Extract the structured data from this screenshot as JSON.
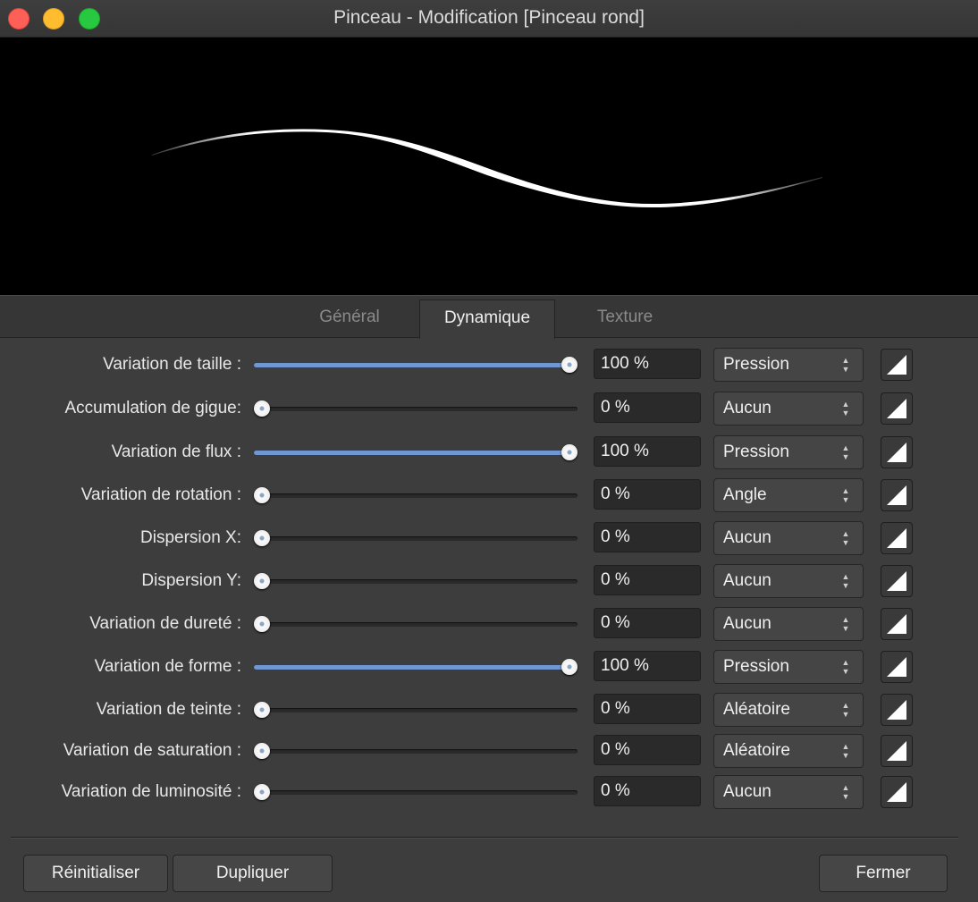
{
  "window": {
    "title": "Pinceau - Modification [Pinceau rond]"
  },
  "tabs": [
    {
      "label": "Général",
      "active": false
    },
    {
      "label": "Dynamique",
      "active": true
    },
    {
      "label": "Texture",
      "active": false
    }
  ],
  "rows": [
    {
      "label": "Variation de taille :",
      "value": "100 %",
      "level": 1.0,
      "controller": "Pression"
    },
    {
      "label": "Accumulation de gigue:",
      "value": "0 %",
      "level": 0.0,
      "controller": "Aucun"
    },
    {
      "label": "Variation de flux :",
      "value": "100 %",
      "level": 1.0,
      "controller": "Pression"
    },
    {
      "label": "Variation de rotation :",
      "value": "0 %",
      "level": 0.0,
      "controller": "Angle"
    },
    {
      "label": "Dispersion X:",
      "value": "0 %",
      "level": 0.0,
      "controller": "Aucun"
    },
    {
      "label": "Dispersion Y:",
      "value": "0 %",
      "level": 0.0,
      "controller": "Aucun"
    },
    {
      "label": "Variation de dureté :",
      "value": "0 %",
      "level": 0.0,
      "controller": "Aucun"
    },
    {
      "label": "Variation de forme :",
      "value": "100 %",
      "level": 1.0,
      "controller": "Pression"
    },
    {
      "label": "Variation de teinte :",
      "value": "0 %",
      "level": 0.0,
      "controller": "Aléatoire"
    },
    {
      "label": "Variation de saturation :",
      "value": "0 %",
      "level": 0.0,
      "controller": "Aléatoire"
    },
    {
      "label": "Variation de luminosité :",
      "value": "0 %",
      "level": 0.0,
      "controller": "Aucun"
    }
  ],
  "buttons": {
    "reset": "Réinitialiser",
    "duplicate": "Dupliquer",
    "close": "Fermer"
  },
  "colors": {
    "accent": "#6f97d2",
    "background": "#3d3d3d",
    "preview_bg": "#000000",
    "stroke": "#ffffff"
  },
  "icons": {
    "curve": "pressure-curve-icon",
    "stepper": "up-down-arrows-icon"
  }
}
